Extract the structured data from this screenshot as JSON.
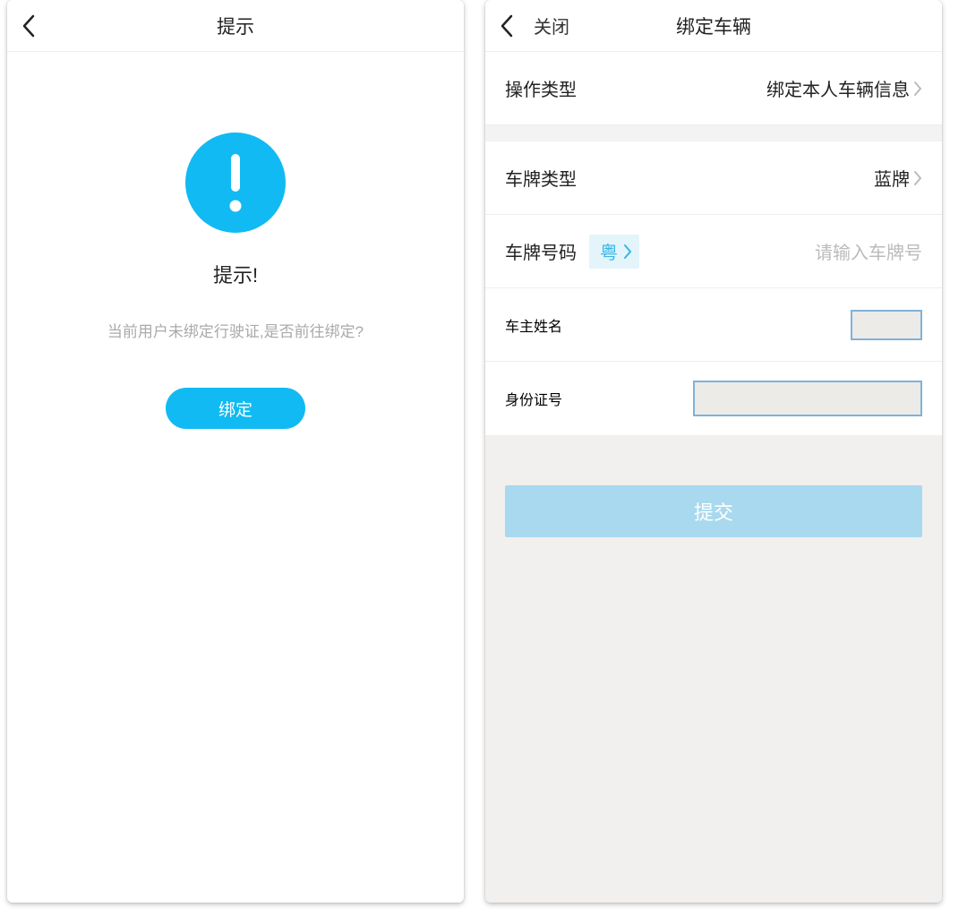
{
  "left": {
    "header": {
      "title": "提示"
    },
    "prompt": {
      "icon": "exclamation-icon",
      "title": "提示!",
      "subtitle": "当前用户未绑定行驶证,是否前往绑定?",
      "button_label": "绑定"
    }
  },
  "right": {
    "header": {
      "close_label": "关闭",
      "title": "绑定车辆"
    },
    "rows": {
      "op_type": {
        "label": "操作类型",
        "value": "绑定本人车辆信息"
      },
      "plate_type": {
        "label": "车牌类型",
        "value": "蓝牌"
      },
      "plate_num": {
        "label": "车牌号码",
        "province": "粤",
        "placeholder": "请输入车牌号"
      },
      "owner": {
        "label": "车主姓名"
      },
      "id": {
        "label": "身份证号"
      }
    },
    "submit_label": "提交"
  }
}
